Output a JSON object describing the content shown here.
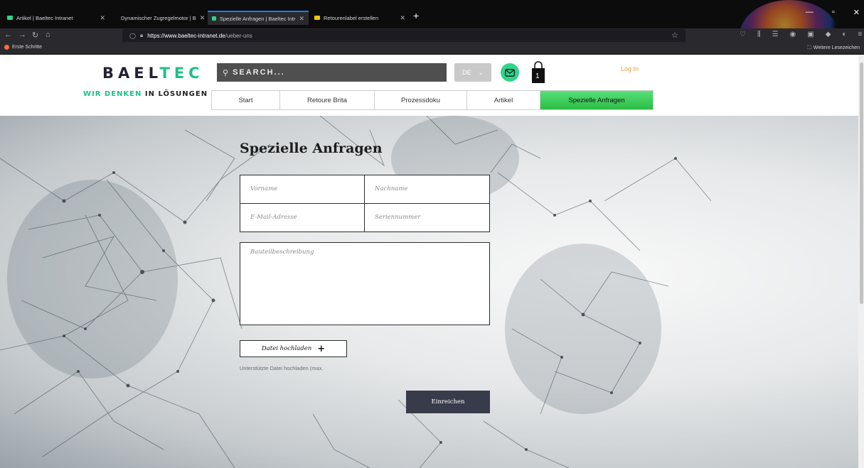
{
  "browser": {
    "tabs": [
      {
        "title": "Artikel | Baeltec Intranet",
        "color": "#2fd48a"
      },
      {
        "title": "Dynamischer Zugregelmotor | B",
        "color": ""
      },
      {
        "title": "Spezielle Anfragen | Baeltec Intr",
        "color": "#2fd48a"
      },
      {
        "title": "Retourenlabel erstellen",
        "color": "#ffc107"
      }
    ],
    "url_host": "https://www.baeltec-intranet.de",
    "url_path": "/ueber-uns",
    "bookmark_first": "Erste Schritte",
    "bookmark_more": "Weitere Lesezeichen"
  },
  "header": {
    "logo_main": "BAEL",
    "logo_accent": "TEC",
    "tagline_green": "WIR DENKEN",
    "tagline_dark": "IN LÖSUNGEN",
    "search_placeholder": "SEARCH...",
    "lang": "DE",
    "cart_count": "1",
    "login": "Log In",
    "menu": [
      "Start",
      "Retoure Brita",
      "Prozessdoku",
      "Artikel",
      "Spezielle Anfragen"
    ],
    "active_menu_color": "#2bbd45"
  },
  "form": {
    "title": "Spezielle Anfragen",
    "first_name": "Vorname",
    "last_name": "Nachname",
    "email": "E-Mail-Adresse",
    "serial": "Seriennummer",
    "description": "Bauteilbeschreibung",
    "upload": "Datei hochladen",
    "upload_hint": "Unterstützte Datei hochladen (max.",
    "submit": "Einreichen"
  },
  "colors": {
    "brand_green": "#1fbf86",
    "submit_bg": "#383b4a",
    "login": "#e3a03f"
  }
}
